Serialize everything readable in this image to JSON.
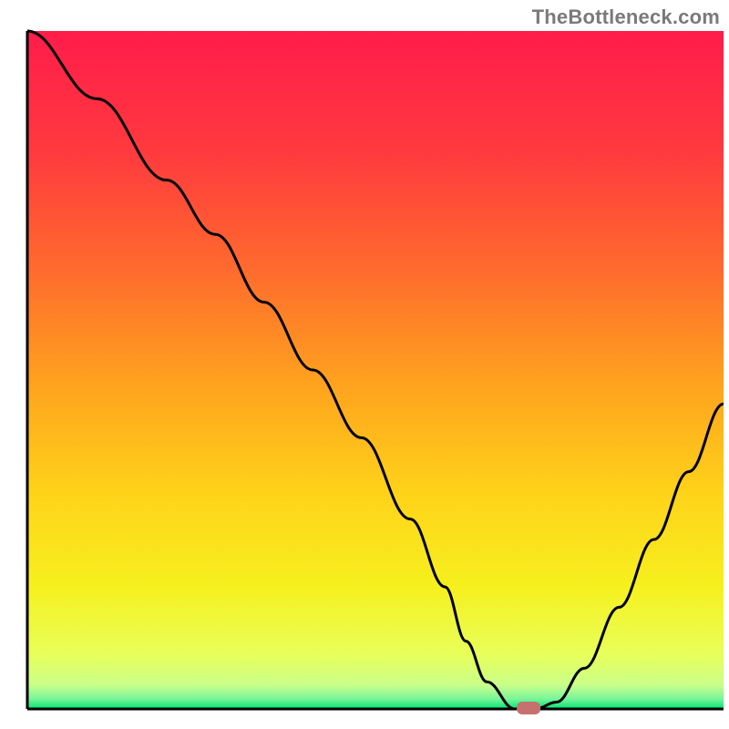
{
  "watermark": "TheBottleneck.com",
  "chart_data": {
    "type": "line",
    "title": "",
    "xlabel": "",
    "ylabel": "",
    "xlim": [
      0,
      100
    ],
    "ylim": [
      0,
      100
    ],
    "grid": false,
    "legend": false,
    "series": [
      {
        "name": "bottleneck-curve",
        "x": [
          0,
          10,
          20,
          27,
          34,
          41,
          48,
          55,
          60,
          63,
          66,
          70,
          73,
          76,
          80,
          85,
          90,
          95,
          100
        ],
        "values": [
          100,
          90,
          78,
          70,
          60,
          50,
          40,
          28,
          18,
          10,
          4,
          0,
          0,
          1,
          6,
          15,
          25,
          35,
          45
        ]
      }
    ],
    "marker": {
      "x": 72,
      "y": 0,
      "label": "optimal-point"
    },
    "gradient_stops": [
      {
        "offset": 0,
        "color": "#ff1c4b"
      },
      {
        "offset": 0.18,
        "color": "#ff3a3e"
      },
      {
        "offset": 0.35,
        "color": "#ff6a2e"
      },
      {
        "offset": 0.52,
        "color": "#ffa21e"
      },
      {
        "offset": 0.68,
        "color": "#ffd21a"
      },
      {
        "offset": 0.82,
        "color": "#f6f01e"
      },
      {
        "offset": 0.92,
        "color": "#e8ff5a"
      },
      {
        "offset": 0.965,
        "color": "#c9ff8a"
      },
      {
        "offset": 0.985,
        "color": "#7af59a"
      },
      {
        "offset": 1.0,
        "color": "#00e572"
      }
    ],
    "axis_color": "#000000",
    "line_color": "#000000",
    "marker_color": "#c77070"
  }
}
